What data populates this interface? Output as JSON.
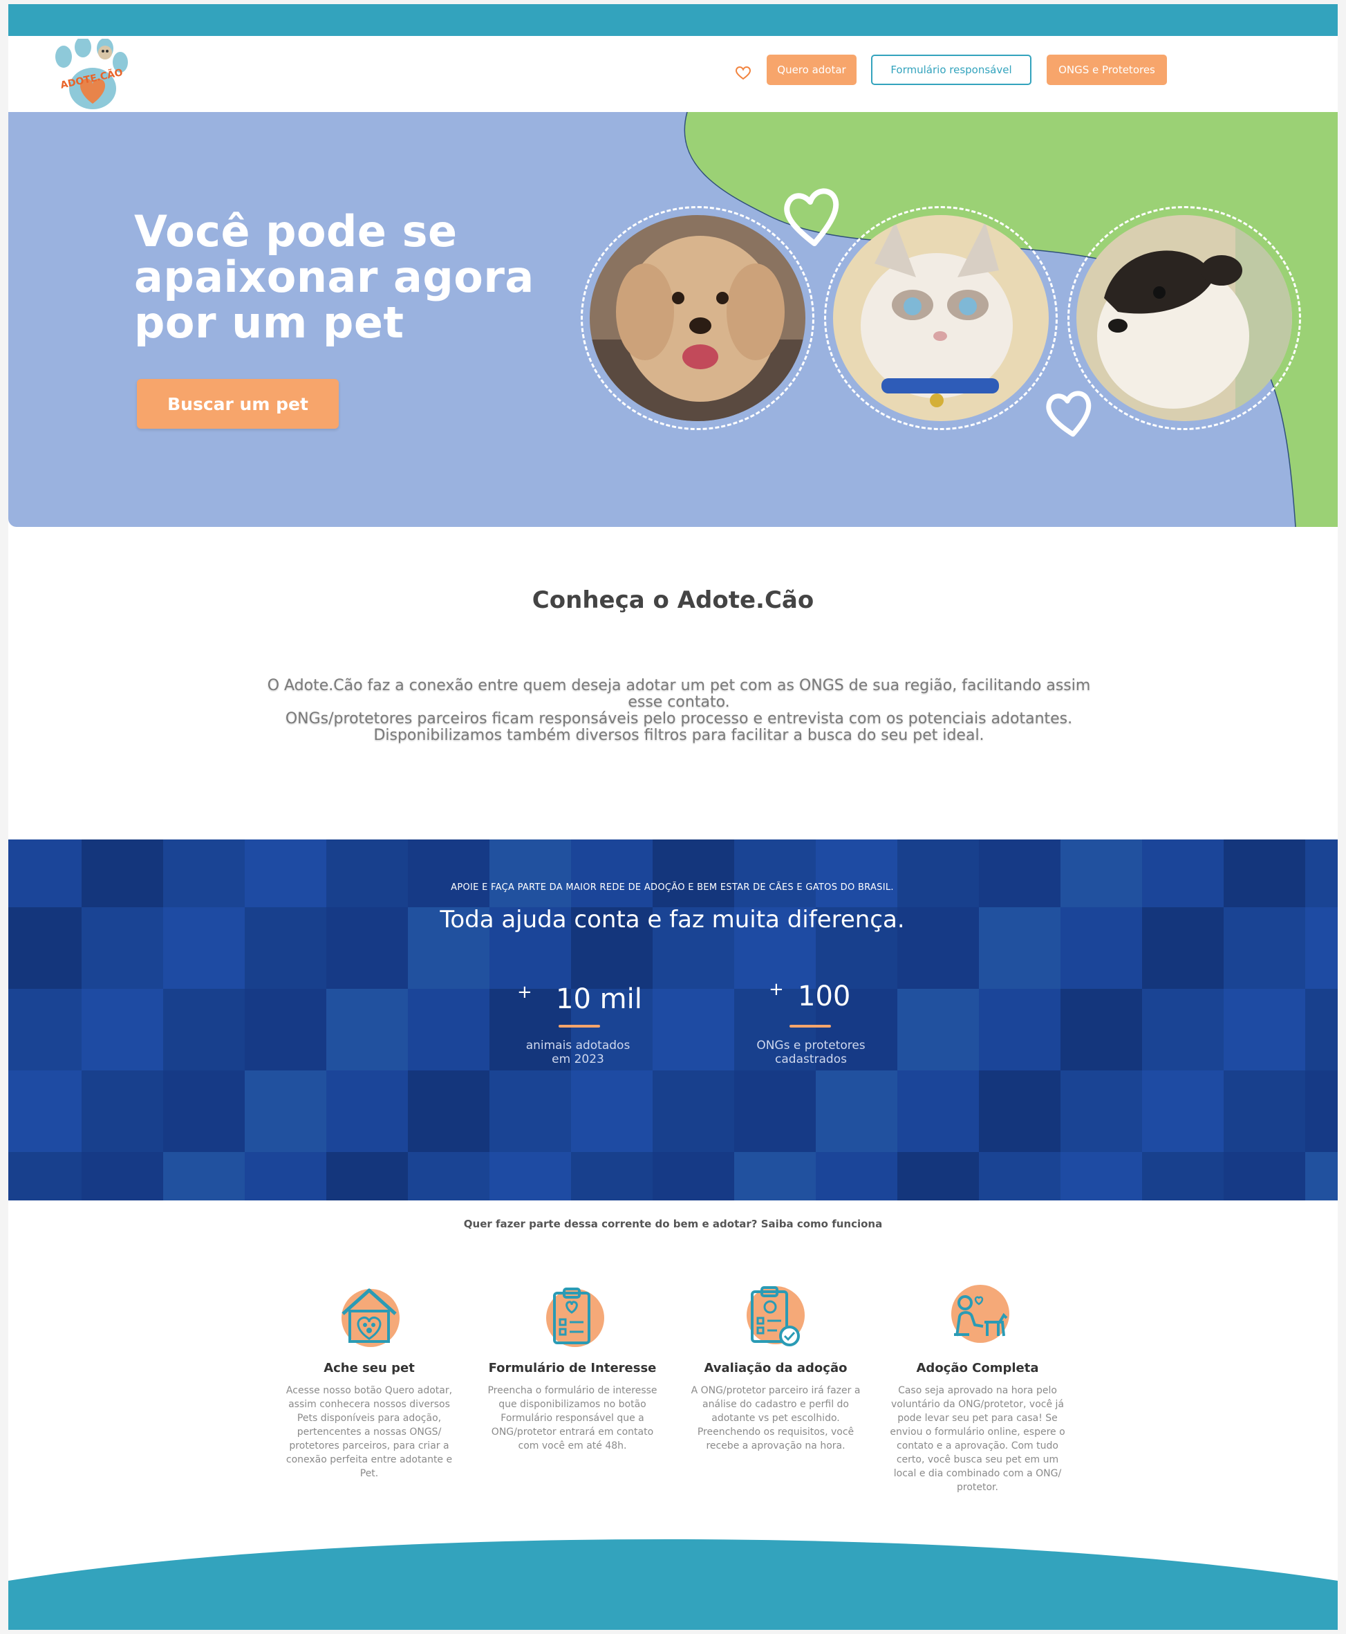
{
  "brand": {
    "name": "Adote.Cão",
    "logo_text": "ADOTE.CÃO"
  },
  "nav": {
    "favorites_icon": "heart-icon",
    "buttons": [
      {
        "label": "Quero adotar"
      },
      {
        "label": "Formulário responsável"
      },
      {
        "label": "ONGS e Protetores"
      }
    ]
  },
  "hero": {
    "title": "Você pode se\napaixonar agora\npor um pet",
    "cta": "Buscar um pet"
  },
  "intro": {
    "title": "Conheça o Adote.Cão",
    "lines": [
      "O Adote.Cão faz a conexão entre quem deseja adotar um pet com as ONGS de sua região, facilitando assim esse contato.",
      "ONGs/protetores parceiros ficam responsáveis pelo processo e entrevista com os potenciais adotantes.",
      "Disponibilizamos também diversos filtros para facilitar a busca do seu pet ideal."
    ]
  },
  "stats": {
    "kicker": "APOIE E FAÇA PARTE DA MAIOR REDE DE ADOÇÃO E BEM ESTAR DE CÃES E GATOS DO BRASIL.",
    "title": "Toda ajuda conta e faz muita diferença.",
    "items": [
      {
        "plus": "+",
        "value": "10 mil",
        "label": "animais adotados\nem 2023"
      },
      {
        "plus": "+",
        "value": "100",
        "label": "ONGs e protetores\ncadastrados"
      }
    ]
  },
  "how": {
    "kicker": "Quer fazer parte dessa corrente do bem e adotar?  Saiba como funciona",
    "steps": [
      {
        "icon": "house-paw-icon",
        "title": "Ache seu pet",
        "text": "Acesse nosso botão Quero adotar, assim conhecera nossos diversos Pets disponíveis para adoção, pertencentes a nossas ONGS/ protetores parceiros, para criar a conexão perfeita entre adotante e Pet."
      },
      {
        "icon": "clipboard-heart-icon",
        "title": "Formulário de Interesse",
        "text": "Preencha o formulário de interesse que disponibilizamos no botão Formulário responsável que a ONG/protetor entrará em contato com você em até 48h."
      },
      {
        "icon": "clipboard-check-icon",
        "title": "Avaliação da adoção",
        "text": "A ONG/protetor parceiro irá fazer a análise do cadastro e perfil do adotante vs pet escolhido. Preenchendo os requisitos, você recebe a aprovação na hora."
      },
      {
        "icon": "person-dog-icon",
        "title": "Adoção Completa",
        "text": "Caso seja aprovado na hora pelo voluntário da ONG/protetor, você já pode levar seu pet para casa! Se enviou o formulário online, espere o contato e a aprovação. Com tudo certo, você busca seu pet em um local e dia combinado com a ONG/ protetor."
      }
    ]
  },
  "colors": {
    "teal": "#33a3bd",
    "orange": "#f7a56b",
    "hero_blue": "#9ab2df",
    "hero_green": "#9bd175",
    "stats_blue": "#173f93"
  }
}
